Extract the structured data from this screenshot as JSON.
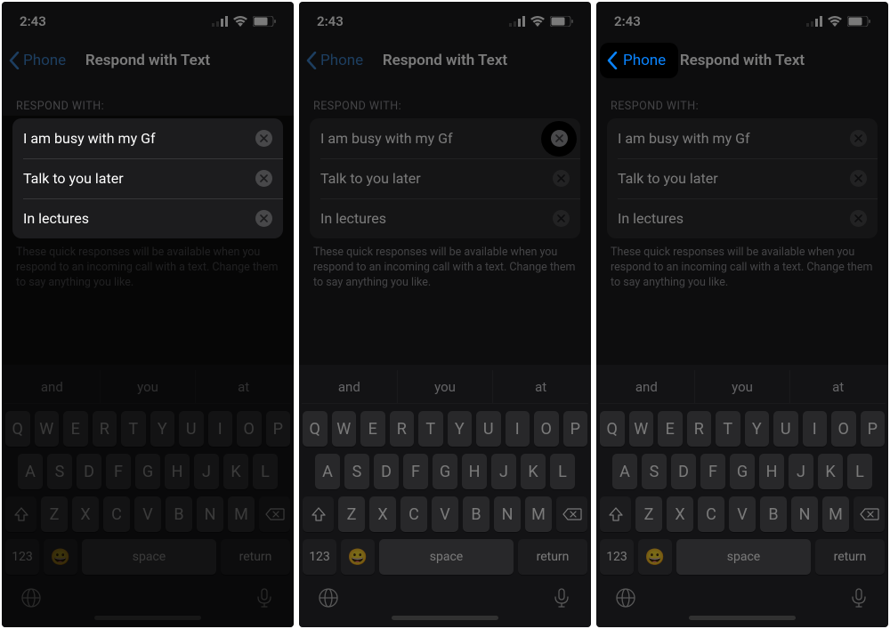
{
  "status": {
    "time": "2:43"
  },
  "nav": {
    "back_label": "Phone",
    "title": "Respond with Text"
  },
  "section": {
    "header": "Respond With:",
    "footer": "These quick responses will be available when you respond to an incoming call with a text. Change them to say anything you like."
  },
  "responses": [
    {
      "text": "I am busy with my Gf"
    },
    {
      "text": "Talk to you later"
    },
    {
      "text": "In lectures"
    }
  ],
  "keyboard": {
    "suggestions": [
      "and",
      "you",
      "at"
    ],
    "row1": [
      "Q",
      "W",
      "E",
      "R",
      "T",
      "Y",
      "U",
      "I",
      "O",
      "P"
    ],
    "row2": [
      "A",
      "S",
      "D",
      "F",
      "G",
      "H",
      "J",
      "K",
      "L"
    ],
    "row3": [
      "Z",
      "X",
      "C",
      "V",
      "B",
      "N",
      "M"
    ],
    "num_key": "123",
    "space_label": "space",
    "return_label": "return"
  }
}
